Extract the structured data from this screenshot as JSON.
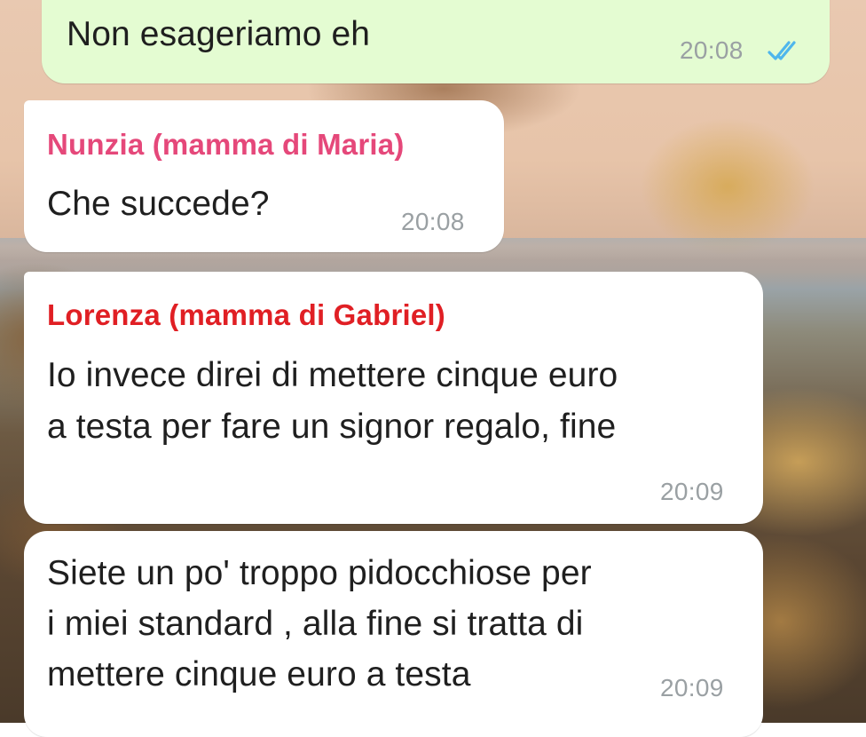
{
  "colors": {
    "outgoing_bubble": "#e4fcd2",
    "incoming_bubble": "#ffffff",
    "sender_nunzia": "#e5487a",
    "sender_lorenza": "#e01f24",
    "read_ticks": "#4fb6ec",
    "timestamp": "#9aa0a3"
  },
  "messages": [
    {
      "direction": "outgoing",
      "text": "Non esageriamo eh",
      "time": "20:08",
      "status_icon": "double-check-read-icon"
    },
    {
      "direction": "incoming",
      "sender": "Nunzia (mamma di Maria)",
      "text": "Che succede?",
      "time": "20:08"
    },
    {
      "direction": "incoming",
      "sender": "Lorenza (mamma di Gabriel)",
      "lines": [
        "Io invece direi di mettere cinque euro",
        "a testa per fare un signor regalo, fine"
      ],
      "time": "20:09"
    },
    {
      "direction": "incoming",
      "lines": [
        "Siete un po' troppo pidocchiose per",
        "i miei standard , alla fine si tratta di",
        "mettere cinque euro a testa"
      ],
      "time": "20:09"
    }
  ]
}
